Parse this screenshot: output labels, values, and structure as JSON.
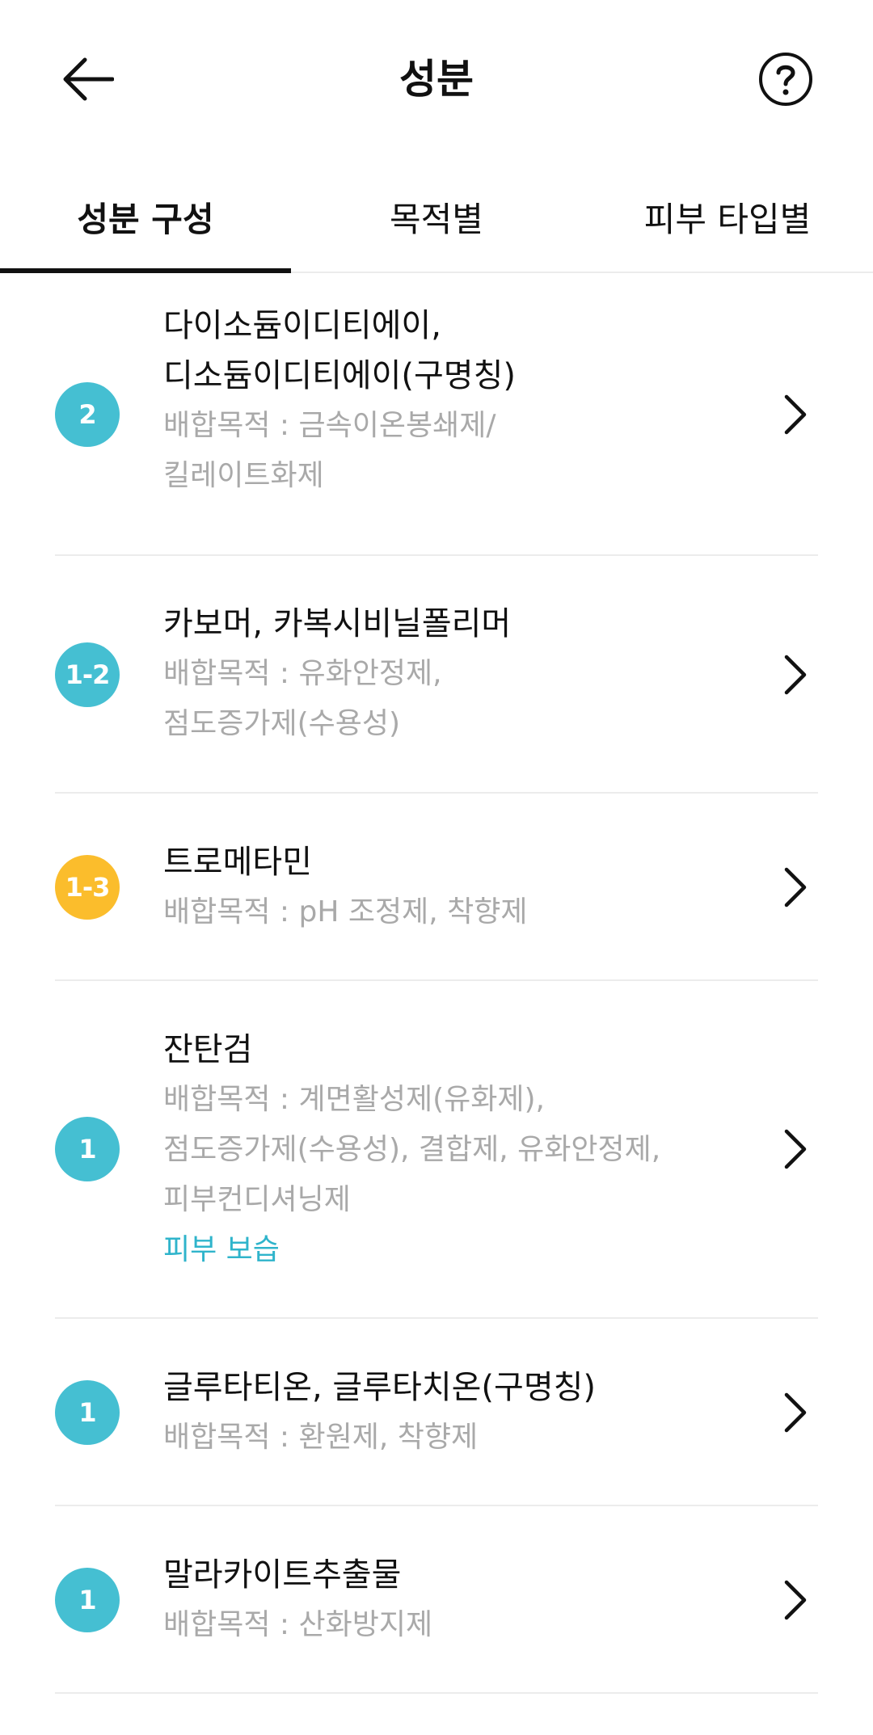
{
  "header": {
    "title": "성분",
    "back_icon": "arrow-left-icon",
    "help_icon": "question-circle-icon"
  },
  "tabs": [
    {
      "label": "성분 구성",
      "active": true
    },
    {
      "label": "목적별",
      "active": false
    },
    {
      "label": "피부 타입별",
      "active": false
    }
  ],
  "ingredients": [
    {
      "grade": "2",
      "grade_color": "#45bfd2",
      "name_lines": [
        "다이소듐이디티에이,",
        "디소듐이디티에이(구명칭)"
      ],
      "purpose_lines": [
        "배합목적 : 금속이온봉쇄제/",
        "킬레이트화제"
      ],
      "tag": ""
    },
    {
      "grade": "1-2",
      "grade_color": "#45bfd2",
      "name_lines": [
        "카보머, 카복시비닐폴리머"
      ],
      "purpose_lines": [
        "배합목적 : 유화안정제,",
        "점도증가제(수용성)"
      ],
      "tag": ""
    },
    {
      "grade": "1-3",
      "grade_color": "#fbbd2c",
      "name_lines": [
        "트로메타민"
      ],
      "purpose_lines": [
        "배합목적 : pH 조정제, 착향제"
      ],
      "tag": ""
    },
    {
      "grade": "1",
      "grade_color": "#45bfd2",
      "name_lines": [
        "잔탄검"
      ],
      "purpose_lines": [
        "배합목적 : 계면활성제(유화제),",
        "점도증가제(수용성), 결합제, 유화안정제,",
        "피부컨디셔닝제"
      ],
      "tag": "피부 보습"
    },
    {
      "grade": "1",
      "grade_color": "#45bfd2",
      "name_lines": [
        "글루타티온, 글루타치온(구명칭)"
      ],
      "purpose_lines": [
        "배합목적 : 환원제, 착향제"
      ],
      "tag": ""
    },
    {
      "grade": "1",
      "grade_color": "#45bfd2",
      "name_lines": [
        "말라카이트추출물"
      ],
      "purpose_lines": [
        "배합목적 : 산화방지제"
      ],
      "tag": ""
    }
  ]
}
